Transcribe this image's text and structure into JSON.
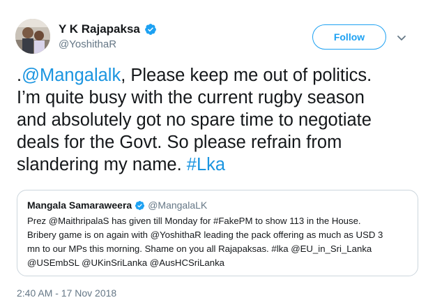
{
  "author": {
    "display_name": "Y K Rajapaksa",
    "handle": "@YoshithaR",
    "verified_icon": "verified-badge-icon",
    "avatar": "profile-photo"
  },
  "follow_button": {
    "label": "Follow"
  },
  "menu_icon": "chevron-down-icon",
  "tweet": {
    "line1_prefix": ".",
    "line1_mention": "@Mangalalk",
    "line1_rest": ", Please keep me out of politics.",
    "line2": "I’m quite busy with the current rugby season",
    "line3": "and absolutely got no spare time to negotiate",
    "line4": "deals for the Govt. So please refrain from",
    "line5_text": "slandering my name. ",
    "line5_hashtag": "#Lka"
  },
  "quoted_tweet": {
    "display_name": "Mangala Samaraweera",
    "handle": "@MangalaLK",
    "line1": "Prez @MaithripalaS has given till Monday for #FakePM to show 113 in the House.",
    "line2": "Bribery game is on again with @YoshithaR leading the pack offering as much as USD 3",
    "line3": "mn to our MPs this morning. Shame on you all Rajapaksas. #lka @EU_in_Sri_Lanka",
    "line4": "@USEmbSL @UKinSriLanka @AusHCSriLanka"
  },
  "timestamp": "2:40 AM - 17 Nov 2018",
  "colors": {
    "accent": "#1da1f2",
    "link": "#1b95e0",
    "text": "#14171a",
    "secondary": "#657786",
    "border": "#ccd6dd"
  }
}
